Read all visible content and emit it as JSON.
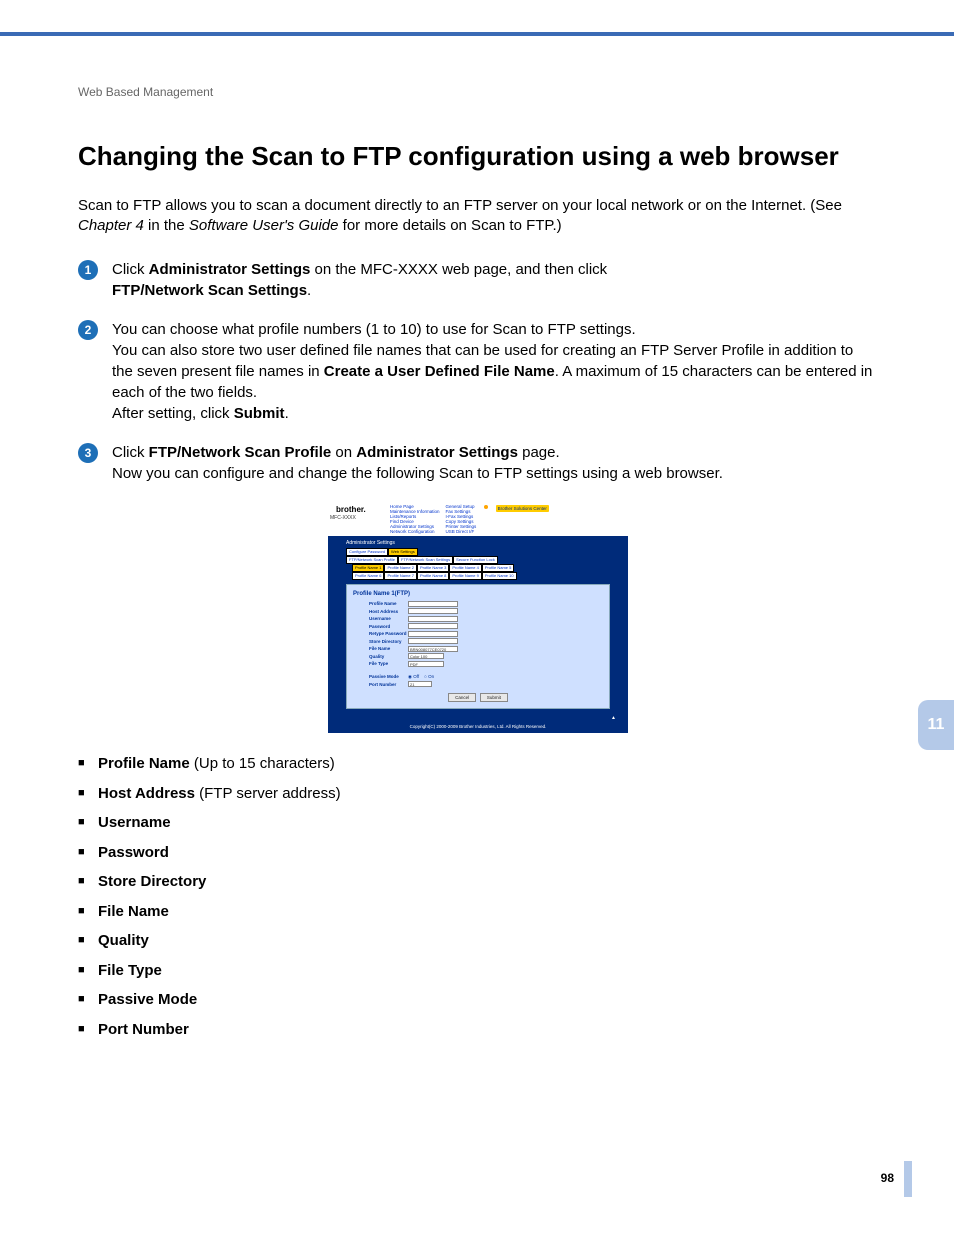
{
  "breadcrumb": "Web Based Management",
  "heading": "Changing the Scan to FTP configuration using a web browser",
  "intro_part1": "Scan to FTP allows you to scan a document directly to an FTP server on your local network or on the Internet. (See ",
  "intro_italic": "Chapter 4",
  "intro_part2": " in the ",
  "intro_italic2": "Software User's Guide",
  "intro_part3": " for more details on Scan to FTP.)",
  "steps": {
    "s1": {
      "num": "1",
      "p1": "Click ",
      "b1": "Administrator Settings",
      "p2": " on the MFC-XXXX web page, and then click ",
      "b2": "FTP/Network Scan Settings",
      "p3": "."
    },
    "s2": {
      "num": "2",
      "p1": "You can choose what profile numbers (1 to 10) to use for Scan to FTP settings.",
      "p2": "You can also store two user defined file names that can be used for creating an FTP Server Profile in addition to the seven present file names in ",
      "b1": "Create a User Defined File Name",
      "p3": ". A maximum of 15 characters can be entered in each of the two fields.",
      "p4": "After setting, click ",
      "b2": "Submit",
      "p5": "."
    },
    "s3": {
      "num": "3",
      "p1": "Click ",
      "b1": "FTP/Network Scan Profile",
      "p2": " on ",
      "b2": "Administrator Settings",
      "p3": " page.",
      "p4": "Now you can configure and change the following Scan to FTP settings using a web browser."
    }
  },
  "screenshot": {
    "brand": "brother.",
    "model": "MFC-XXXX",
    "nav_col1": [
      "Home Page",
      "Maintenance Information",
      "Lists/Reports",
      "Find Device",
      "Administrator Settings",
      "Network Configuration"
    ],
    "nav_col2": [
      "General Setup",
      "Fax Settings",
      "I-Fax Settings",
      "Copy Settings",
      "Printer Settings",
      "USB Direct I/F"
    ],
    "solutions_center": "Brother Solutions Center",
    "admin_label": "Administrator Settings",
    "tabs_row1": [
      "Configure Password",
      "Web Settings"
    ],
    "tabs_row2": [
      "FTP/Network Scan Profile",
      "FTP/Network Scan Settings",
      "Secure Function Lock"
    ],
    "tabs_row3": [
      "Profile Name 1",
      "Profile Name 2",
      "Profile Name 3",
      "Profile Name 4",
      "Profile Name 5"
    ],
    "tabs_row4": [
      "Profile Name 6",
      "Profile Name 7",
      "Profile Name 8",
      "Profile Name 9",
      "Profile Name 10"
    ],
    "form_title": "Profile Name 1(FTP)",
    "fields": {
      "profile_name": "Profile Name",
      "host_address": "Host Address",
      "username": "Username",
      "password": "Password",
      "retype_password": "Retype Password",
      "store_directory": "Store Directory",
      "file_name": "File Name",
      "file_name_val": "BRN008077CE0720",
      "quality": "Quality",
      "quality_val": "Color 100",
      "file_type": "File Type",
      "file_type_val": "PDF",
      "passive_mode": "Passive Mode",
      "passive_off": "Off",
      "passive_on": "On",
      "port_number": "Port Number",
      "port_number_val": "21"
    },
    "cancel": "Cancel",
    "submit": "Submit",
    "copyright": "Copyright(C) 2000-2009 Brother Industries, Ltd. All Rights Reserved."
  },
  "bullets": {
    "b1_bold": "Profile Name",
    "b1_rest": " (Up to 15 characters)",
    "b2_bold": "Host Address",
    "b2_rest": " (FTP server address)",
    "b3_bold": "Username",
    "b4_bold": "Password",
    "b5_bold": "Store Directory",
    "b6_bold": "File Name",
    "b7_bold": "Quality",
    "b8_bold": "File Type",
    "b9_bold": "Passive Mode",
    "b10_bold": "Port Number"
  },
  "side_tab": "11",
  "page_num": "98"
}
